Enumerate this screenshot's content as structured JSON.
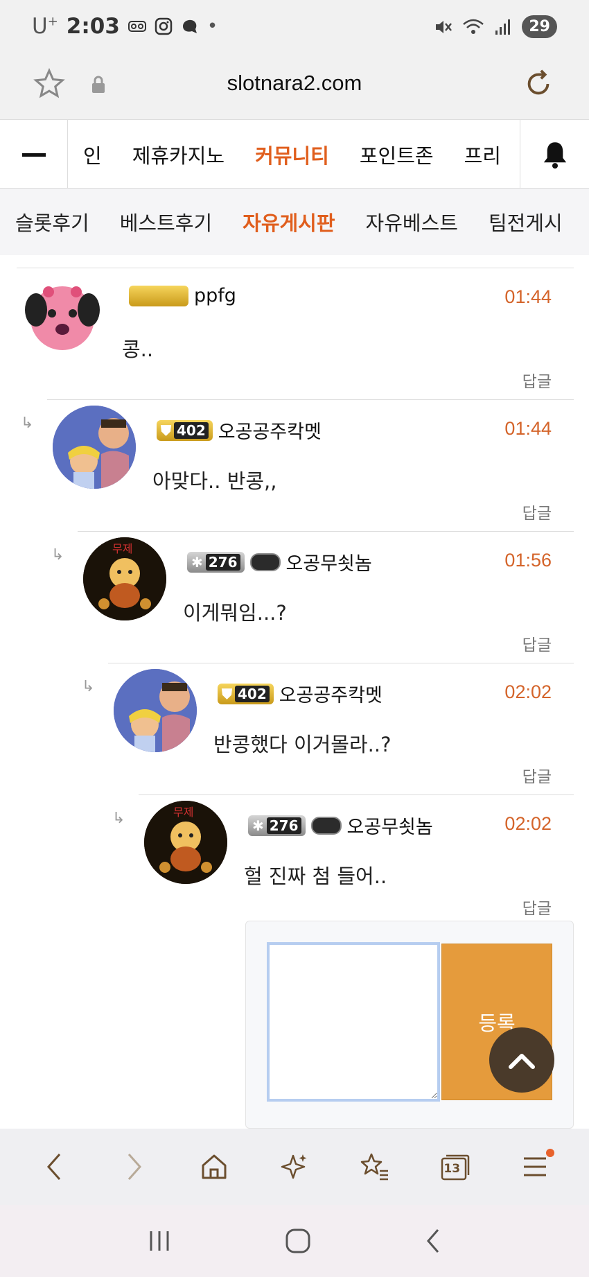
{
  "status_bar": {
    "carrier": "U",
    "carrier_sup": "+",
    "time": "2:03",
    "battery": "29"
  },
  "address_bar": {
    "url": "slotnara2.com"
  },
  "main_nav": {
    "items": [
      {
        "label": "인",
        "active": false
      },
      {
        "label": "제휴카지노",
        "active": false
      },
      {
        "label": "커뮤니티",
        "active": true
      },
      {
        "label": "포인트존",
        "active": false
      },
      {
        "label": "프리",
        "active": false
      }
    ]
  },
  "sub_nav": {
    "items": [
      {
        "label": "슬롯후기",
        "active": false
      },
      {
        "label": "베스트후기",
        "active": false
      },
      {
        "label": "자유게시판",
        "active": true
      },
      {
        "label": "자유베스트",
        "active": false
      },
      {
        "label": "팀전게시",
        "active": false
      }
    ]
  },
  "comments": [
    {
      "user": "ppfg",
      "level": "",
      "time": "01:44",
      "text": "콩..",
      "reply_label": "답글"
    },
    {
      "user": "오공공주칵멧",
      "level": "402",
      "time": "01:44",
      "text": "아맞다.. 반콩,,",
      "reply_label": "답글"
    },
    {
      "user": "오공무쇳놈",
      "level": "276",
      "time": "01:56",
      "text": "이게뭐임...?",
      "reply_label": "답글"
    },
    {
      "user": "오공공주칵멧",
      "level": "402",
      "time": "02:02",
      "text": "반콩했다 이거몰라..?",
      "reply_label": "답글"
    },
    {
      "user": "오공무쇳놈",
      "level": "276",
      "time": "02:02",
      "text": "헐 진짜 첨 들어..",
      "reply_label": "답글"
    }
  ],
  "reply_form": {
    "submit_label": "등록"
  },
  "bottom_bar": {
    "tabs_count": "13"
  },
  "colors": {
    "accent": "#e05e1d",
    "time": "#d4642a",
    "submit": "#e59b3c"
  }
}
